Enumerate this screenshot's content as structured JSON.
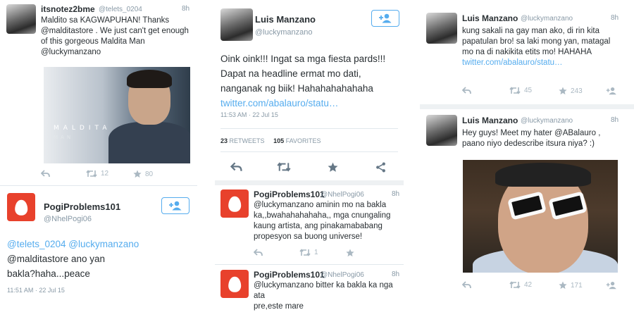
{
  "columns": [
    {
      "tweets": [
        {
          "name": "itsnotez2bme",
          "handle": "@telets_0204",
          "time": "8h",
          "lines": [
            "Maldito sa KAGWAPUHAN! Thanks",
            "@malditastore . We just can't get enough",
            "of this gorgeous Maldita Man",
            "@luckymanzano"
          ],
          "image_text": [
            "MALDITA",
            "MAN"
          ],
          "retweets": "12",
          "favorites": "80"
        },
        {
          "name": "PogiProblems101",
          "handle": "@NhelPogi06",
          "lines": [
            "@telets_0204 @luckymanzano",
            "@malditastore ano yan",
            "bakla?haha...peace"
          ],
          "timestamp": "11:51 AM · 22 Jul 15"
        }
      ]
    },
    {
      "tweets": [
        {
          "name": "Luis Manzano",
          "handle": "@luckymanzano",
          "lines": [
            "Oink oink!!! Ingat sa mga fiesta pards!!!",
            "Dapat na headline ermat mo dati,",
            "nanganak ng biik! Hahahahahahaha"
          ],
          "link": "twitter.com/abalauro/statu…",
          "timestamp": "11:53 AM · 22 Jul 15",
          "retweets_count": "23",
          "retweets_label": "RETWEETS",
          "favorites_count": "105",
          "favorites_label": "FAVORITES"
        },
        {
          "name": "PogiProblems101",
          "handle": "@NhelPogi06",
          "time": "8h",
          "lines": [
            "@luckymanzano aminin mo na bakla",
            "ka,,bwahahahahaha,, mga cnungaling",
            "kaung artista, ang pinakamababang",
            "propesyon sa buong universe!"
          ],
          "retweets": "1"
        },
        {
          "name": "PogiProblems101",
          "handle": "@NhelPogi06",
          "time": "8h",
          "lines": [
            "@luckymanzano bitter ka bakla ka nga ata",
            "pre,este mare"
          ]
        }
      ]
    },
    {
      "tweets": [
        {
          "name": "Luis Manzano",
          "handle": "@luckymanzano",
          "time": "8h",
          "lines": [
            "kung sakali na gay man ako, di rin kita",
            "papatulan bro! sa laki mong yan, matagal",
            "mo na di nakikita etits mo! HAHAHA"
          ],
          "link": "twitter.com/abalauro/statu…",
          "retweets": "45",
          "favorites": "243"
        },
        {
          "name": "Luis Manzano",
          "handle": "@luckymanzano",
          "time": "8h",
          "lines": [
            "Hey guys! Meet my hater @ABalauro ,",
            "paano niyo dedescribe itsura niya? :)"
          ],
          "retweets": "42",
          "favorites": "171"
        }
      ]
    }
  ],
  "colors": {
    "link": "#55acee",
    "egg_avatar": "#e8412c",
    "icon_gray": "#aab8c2",
    "meta_gray": "#8899a6"
  }
}
